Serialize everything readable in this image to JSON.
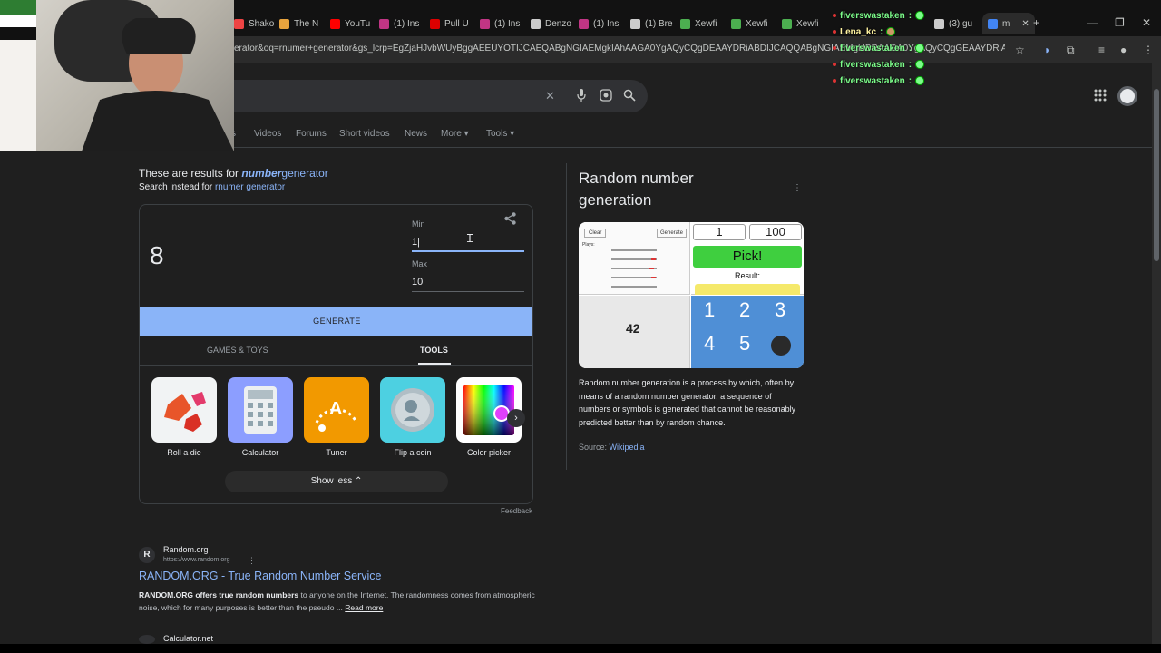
{
  "browser": {
    "tabs": [
      {
        "label": "Shako",
        "color": "#e44"
      },
      {
        "label": "The N",
        "color": "#e8a33d"
      },
      {
        "label": "YouTu",
        "color": "#f00"
      },
      {
        "label": "(1) Ins",
        "color": "#c13584"
      },
      {
        "label": "Pull U",
        "color": "#d00"
      },
      {
        "label": "(1) Ins",
        "color": "#c13584"
      },
      {
        "label": "Denzo",
        "color": "#ccc"
      },
      {
        "label": "(1) Ins",
        "color": "#c13584"
      },
      {
        "label": "(1) Bre",
        "color": "#ccc"
      },
      {
        "label": "Xewfi",
        "color": "#4caf50"
      },
      {
        "label": "Xewfi",
        "color": "#4caf50"
      },
      {
        "label": "Xewfi",
        "color": "#4caf50"
      },
      {
        "label": "(3) gu",
        "color": "#ccc"
      },
      {
        "label": "m",
        "color": "#4285f4"
      }
    ],
    "new_tab": "+",
    "window_controls": {
      "minimize": "—",
      "maximize": "❐",
      "close": "✕"
    },
    "url": "erator&oq=rnumer+generator&gs_lcrp=EgZjaHJvbWUyBggAEEUYOTIJCAEQABgNGIAEMgkIAhAAGA0YgAQyCQgDEAAYDRiABDIJCAQQABgNGIAEMgkIBRAAGA0YgAQyCQgGEAAYDRiABDIJCAcQABgNGIAEM..."
  },
  "google": {
    "search_clear": "✕",
    "filters": [
      "s",
      "Videos",
      "Forums",
      "Short videos",
      "News",
      "More",
      "Tools"
    ],
    "results_for_prefix": "These are results for",
    "results_for_query_bold": "number",
    "results_for_query_rest": "generator",
    "search_instead_prefix": "Search instead for",
    "search_instead_link": "rnumer generator"
  },
  "rng": {
    "result": "8",
    "min_label": "Min",
    "min_value": "1|",
    "max_label": "Max",
    "max_value": "10",
    "generate_label": "GENERATE",
    "tab_games": "GAMES & TOYS",
    "tab_tools": "TOOLS",
    "tools": [
      "Roll a die",
      "Calculator",
      "Tuner",
      "Flip a coin",
      "Color picker"
    ],
    "tuner_letter": "A",
    "show_less": "Show less",
    "feedback": "Feedback"
  },
  "results": [
    {
      "site": "Random.org",
      "favicon_letter": "R",
      "url": "https://www.random.org",
      "title": "RANDOM.ORG - True Random Number Service",
      "snippet_bold1": "RANDOM.ORG offers true random numbers",
      "snippet_rest1": " to anyone on the Internet. The randomness comes from atmospheric noise, which for many purposes is better than the pseudo ...",
      "read_more": "Read more"
    },
    {
      "site": "Calculator.net"
    }
  ],
  "knowledge_panel": {
    "title": "Random number generation",
    "image_labels": {
      "clear": "Clear",
      "generate": "Generate",
      "plays": "Plays:",
      "num1": "1",
      "num100": "100",
      "pick": "Pick!",
      "result": "Result:",
      "big_number": "42",
      "grid": [
        "1",
        "2",
        "3",
        "4",
        "5"
      ]
    },
    "description": "Random number generation is a process by which, often by means of a random number generator, a sequence of numbers or symbols is generated that cannot be reasonably predicted better than by random chance.",
    "source_label": "Source:",
    "source_link": "Wikipedia"
  },
  "chat": {
    "user": "fiverswastaken",
    "user2": "Lena_kc",
    "separator": ":"
  }
}
